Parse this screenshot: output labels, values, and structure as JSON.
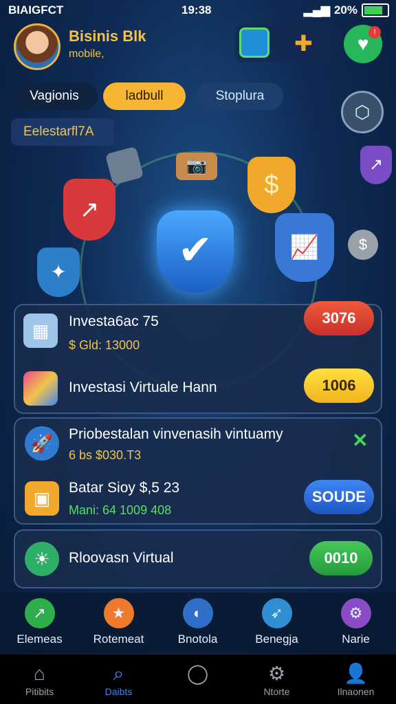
{
  "status": {
    "carrier": "BIAIGFCT",
    "time": "19:38",
    "battery": "20%"
  },
  "header": {
    "title": "Bisinis Blk",
    "subtitle": "mobile,"
  },
  "tabs": [
    {
      "label": "Vagionis"
    },
    {
      "label": "ladbull"
    },
    {
      "label": "Stoplura"
    }
  ],
  "category": "Eelestarfl7A",
  "cards": [
    {
      "title": "Investa6ac 75",
      "sub": "$ Gld: 13000",
      "amount": "3076"
    },
    {
      "title": "Investasi Virtuale Hann",
      "amount": "1006"
    },
    {
      "title": "Priobestalan vinvenasih vintuamy",
      "sub": "6 bs $030.T3"
    },
    {
      "title": "Batar Sioy $,5 23",
      "sub": "Mani: 64 1009 408",
      "amount": "SOUDE"
    },
    {
      "title": "Rloovasn Virtual",
      "amount": "0010"
    }
  ],
  "nav": [
    {
      "label": "Elemeas"
    },
    {
      "label": "Rotemeat"
    },
    {
      "label": "Bnotola"
    },
    {
      "label": "Benegja"
    },
    {
      "label": "Narie"
    }
  ],
  "tabbar": [
    {
      "label": "Pitibits"
    },
    {
      "label": "Daibts"
    },
    {
      "label": ""
    },
    {
      "label": "Ntorte"
    },
    {
      "label": "Ilnaonen"
    }
  ],
  "colors": {
    "accent": "#f3c34b",
    "active_tab": "#f6b532"
  }
}
